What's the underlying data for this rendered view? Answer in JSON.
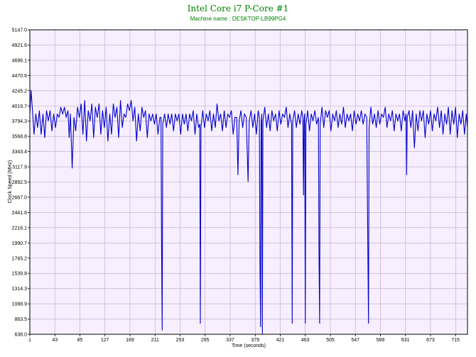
{
  "chart_data": {
    "type": "line",
    "title": "Intel Core i7 P-Core #1",
    "subtitle": "Machine name : DESKTOP-LB99PG4",
    "xlabel": "Time (seconds)",
    "ylabel": "Clock Speed (MHz)",
    "xlim": [
      1,
      735
    ],
    "ylim": [
      638.0,
      5147.0
    ],
    "xticks": [
      1,
      43,
      85,
      127,
      169,
      211,
      253,
      295,
      337,
      379,
      421,
      463,
      505,
      547,
      589,
      631,
      673,
      715
    ],
    "yticks": [
      638.0,
      863.5,
      1088.9,
      1314.3,
      1539.8,
      1765.2,
      1990.7,
      2216.1,
      2441.6,
      2667.0,
      2892.5,
      3117.9,
      3343.4,
      3568.8,
      3794.3,
      4019.7,
      4245.2,
      4470.6,
      4696.1,
      4921.6,
      5147.0
    ],
    "grid": true,
    "colors": {
      "line": "#0000cc",
      "plot_bg": "#f7eeff",
      "grid": "#b9a8c8",
      "title": "#008000"
    },
    "series": [
      {
        "values": [
          {
            "x": 1,
            "y": 3900
          },
          {
            "x": 3,
            "y": 4250
          },
          {
            "x": 5,
            "y": 4000
          },
          {
            "x": 8,
            "y": 3600
          },
          {
            "x": 11,
            "y": 3900
          },
          {
            "x": 14,
            "y": 3700
          },
          {
            "x": 17,
            "y": 3950
          },
          {
            "x": 20,
            "y": 3600
          },
          {
            "x": 23,
            "y": 3900
          },
          {
            "x": 26,
            "y": 3550
          },
          {
            "x": 29,
            "y": 3950
          },
          {
            "x": 32,
            "y": 3800
          },
          {
            "x": 35,
            "y": 3950
          },
          {
            "x": 38,
            "y": 3650
          },
          {
            "x": 41,
            "y": 3900
          },
          {
            "x": 44,
            "y": 3700
          },
          {
            "x": 47,
            "y": 3900
          },
          {
            "x": 50,
            "y": 3850
          },
          {
            "x": 53,
            "y": 4000
          },
          {
            "x": 56,
            "y": 3900
          },
          {
            "x": 59,
            "y": 4000
          },
          {
            "x": 62,
            "y": 3850
          },
          {
            "x": 65,
            "y": 3950
          },
          {
            "x": 67,
            "y": 3550
          },
          {
            "x": 69,
            "y": 3900
          },
          {
            "x": 72,
            "y": 3100
          },
          {
            "x": 75,
            "y": 3850
          },
          {
            "x": 78,
            "y": 3650
          },
          {
            "x": 81,
            "y": 4000
          },
          {
            "x": 84,
            "y": 3850
          },
          {
            "x": 87,
            "y": 4050
          },
          {
            "x": 90,
            "y": 3600
          },
          {
            "x": 93,
            "y": 4100
          },
          {
            "x": 96,
            "y": 3500
          },
          {
            "x": 99,
            "y": 3950
          },
          {
            "x": 102,
            "y": 3800
          },
          {
            "x": 105,
            "y": 4050
          },
          {
            "x": 108,
            "y": 3550
          },
          {
            "x": 111,
            "y": 4000
          },
          {
            "x": 114,
            "y": 3850
          },
          {
            "x": 117,
            "y": 4050
          },
          {
            "x": 120,
            "y": 3600
          },
          {
            "x": 123,
            "y": 3950
          },
          {
            "x": 126,
            "y": 3700
          },
          {
            "x": 129,
            "y": 4000
          },
          {
            "x": 132,
            "y": 3500
          },
          {
            "x": 135,
            "y": 3900
          },
          {
            "x": 138,
            "y": 3600
          },
          {
            "x": 141,
            "y": 4050
          },
          {
            "x": 144,
            "y": 3850
          },
          {
            "x": 147,
            "y": 4000
          },
          {
            "x": 150,
            "y": 3550
          },
          {
            "x": 153,
            "y": 4100
          },
          {
            "x": 156,
            "y": 3700
          },
          {
            "x": 159,
            "y": 3900
          },
          {
            "x": 162,
            "y": 3850
          },
          {
            "x": 165,
            "y": 4050
          },
          {
            "x": 168,
            "y": 3950
          },
          {
            "x": 171,
            "y": 4100
          },
          {
            "x": 174,
            "y": 3800
          },
          {
            "x": 177,
            "y": 4000
          },
          {
            "x": 180,
            "y": 3500
          },
          {
            "x": 183,
            "y": 3900
          },
          {
            "x": 186,
            "y": 3650
          },
          {
            "x": 189,
            "y": 4000
          },
          {
            "x": 192,
            "y": 3850
          },
          {
            "x": 195,
            "y": 3950
          },
          {
            "x": 198,
            "y": 3550
          },
          {
            "x": 201,
            "y": 3900
          },
          {
            "x": 204,
            "y": 3800
          },
          {
            "x": 207,
            "y": 3900
          },
          {
            "x": 210,
            "y": 3750
          },
          {
            "x": 213,
            "y": 3900
          },
          {
            "x": 216,
            "y": 3600
          },
          {
            "x": 219,
            "y": 3850
          },
          {
            "x": 221,
            "y": 3850
          },
          {
            "x": 222,
            "y": 1850
          },
          {
            "x": 223,
            "y": 700
          },
          {
            "x": 224,
            "y": 3750
          },
          {
            "x": 227,
            "y": 3900
          },
          {
            "x": 230,
            "y": 3700
          },
          {
            "x": 233,
            "y": 3900
          },
          {
            "x": 236,
            "y": 3750
          },
          {
            "x": 239,
            "y": 3900
          },
          {
            "x": 242,
            "y": 3650
          },
          {
            "x": 245,
            "y": 3900
          },
          {
            "x": 248,
            "y": 3800
          },
          {
            "x": 251,
            "y": 3900
          },
          {
            "x": 254,
            "y": 3600
          },
          {
            "x": 257,
            "y": 3900
          },
          {
            "x": 260,
            "y": 3750
          },
          {
            "x": 263,
            "y": 3900
          },
          {
            "x": 266,
            "y": 3650
          },
          {
            "x": 269,
            "y": 3900
          },
          {
            "x": 272,
            "y": 3800
          },
          {
            "x": 275,
            "y": 3950
          },
          {
            "x": 278,
            "y": 3600
          },
          {
            "x": 281,
            "y": 3900
          },
          {
            "x": 284,
            "y": 3700
          },
          {
            "x": 286,
            "y": 3750
          },
          {
            "x": 287,
            "y": 800
          },
          {
            "x": 288,
            "y": 3700
          },
          {
            "x": 291,
            "y": 3950
          },
          {
            "x": 294,
            "y": 3700
          },
          {
            "x": 297,
            "y": 3900
          },
          {
            "x": 300,
            "y": 3800
          },
          {
            "x": 303,
            "y": 3950
          },
          {
            "x": 306,
            "y": 3650
          },
          {
            "x": 309,
            "y": 3900
          },
          {
            "x": 312,
            "y": 3700
          },
          {
            "x": 315,
            "y": 4050
          },
          {
            "x": 318,
            "y": 3800
          },
          {
            "x": 321,
            "y": 3900
          },
          {
            "x": 324,
            "y": 3650
          },
          {
            "x": 327,
            "y": 3950
          },
          {
            "x": 330,
            "y": 3700
          },
          {
            "x": 333,
            "y": 3900
          },
          {
            "x": 336,
            "y": 3850
          },
          {
            "x": 339,
            "y": 3950
          },
          {
            "x": 342,
            "y": 3600
          },
          {
            "x": 345,
            "y": 3850
          },
          {
            "x": 348,
            "y": 3850
          },
          {
            "x": 350,
            "y": 3000
          },
          {
            "x": 352,
            "y": 3800
          },
          {
            "x": 355,
            "y": 3950
          },
          {
            "x": 358,
            "y": 3700
          },
          {
            "x": 361,
            "y": 3900
          },
          {
            "x": 364,
            "y": 3850
          },
          {
            "x": 367,
            "y": 2900
          },
          {
            "x": 369,
            "y": 3800
          },
          {
            "x": 372,
            "y": 3950
          },
          {
            "x": 375,
            "y": 3700
          },
          {
            "x": 378,
            "y": 3900
          },
          {
            "x": 381,
            "y": 3600
          },
          {
            "x": 384,
            "y": 3950
          },
          {
            "x": 386,
            "y": 3850
          },
          {
            "x": 387,
            "y": 1700
          },
          {
            "x": 388,
            "y": 750
          },
          {
            "x": 389,
            "y": 3750
          },
          {
            "x": 390,
            "y": 3900
          },
          {
            "x": 391,
            "y": 650
          },
          {
            "x": 392,
            "y": 3800
          },
          {
            "x": 395,
            "y": 4000
          },
          {
            "x": 398,
            "y": 3700
          },
          {
            "x": 401,
            "y": 3900
          },
          {
            "x": 404,
            "y": 3650
          },
          {
            "x": 407,
            "y": 3950
          },
          {
            "x": 410,
            "y": 3800
          },
          {
            "x": 413,
            "y": 3900
          },
          {
            "x": 416,
            "y": 3650
          },
          {
            "x": 419,
            "y": 3950
          },
          {
            "x": 422,
            "y": 3750
          },
          {
            "x": 425,
            "y": 3900
          },
          {
            "x": 428,
            "y": 3850
          },
          {
            "x": 431,
            "y": 4000
          },
          {
            "x": 434,
            "y": 3700
          },
          {
            "x": 437,
            "y": 3900
          },
          {
            "x": 440,
            "y": 3750
          },
          {
            "x": 441,
            "y": 800
          },
          {
            "x": 442,
            "y": 3800
          },
          {
            "x": 445,
            "y": 3950
          },
          {
            "x": 448,
            "y": 3700
          },
          {
            "x": 451,
            "y": 3900
          },
          {
            "x": 454,
            "y": 3750
          },
          {
            "x": 457,
            "y": 3950
          },
          {
            "x": 459,
            "y": 3850
          },
          {
            "x": 460,
            "y": 2700
          },
          {
            "x": 461,
            "y": 3800
          },
          {
            "x": 462,
            "y": 3900
          },
          {
            "x": 463,
            "y": 800
          },
          {
            "x": 464,
            "y": 3750
          },
          {
            "x": 467,
            "y": 3950
          },
          {
            "x": 470,
            "y": 3650
          },
          {
            "x": 473,
            "y": 3900
          },
          {
            "x": 476,
            "y": 3800
          },
          {
            "x": 479,
            "y": 3950
          },
          {
            "x": 482,
            "y": 3750
          },
          {
            "x": 485,
            "y": 3850
          },
          {
            "x": 486,
            "y": 1850
          },
          {
            "x": 487,
            "y": 800
          },
          {
            "x": 488,
            "y": 3750
          },
          {
            "x": 491,
            "y": 4000
          },
          {
            "x": 494,
            "y": 3700
          },
          {
            "x": 497,
            "y": 3950
          },
          {
            "x": 500,
            "y": 3850
          },
          {
            "x": 503,
            "y": 3950
          },
          {
            "x": 506,
            "y": 3650
          },
          {
            "x": 509,
            "y": 3900
          },
          {
            "x": 512,
            "y": 3800
          },
          {
            "x": 515,
            "y": 3950
          },
          {
            "x": 518,
            "y": 3700
          },
          {
            "x": 521,
            "y": 3900
          },
          {
            "x": 524,
            "y": 3750
          },
          {
            "x": 527,
            "y": 4000
          },
          {
            "x": 530,
            "y": 3700
          },
          {
            "x": 533,
            "y": 3900
          },
          {
            "x": 536,
            "y": 3800
          },
          {
            "x": 539,
            "y": 3900
          },
          {
            "x": 542,
            "y": 3650
          },
          {
            "x": 545,
            "y": 3950
          },
          {
            "x": 548,
            "y": 3750
          },
          {
            "x": 551,
            "y": 3900
          },
          {
            "x": 554,
            "y": 3800
          },
          {
            "x": 557,
            "y": 3950
          },
          {
            "x": 560,
            "y": 3750
          },
          {
            "x": 563,
            "y": 3900
          },
          {
            "x": 566,
            "y": 3850
          },
          {
            "x": 568,
            "y": 1850
          },
          {
            "x": 569,
            "y": 800
          },
          {
            "x": 570,
            "y": 3700
          },
          {
            "x": 573,
            "y": 4000
          },
          {
            "x": 576,
            "y": 3750
          },
          {
            "x": 579,
            "y": 3900
          },
          {
            "x": 582,
            "y": 3700
          },
          {
            "x": 585,
            "y": 3950
          },
          {
            "x": 588,
            "y": 3750
          },
          {
            "x": 591,
            "y": 3900
          },
          {
            "x": 594,
            "y": 3850
          },
          {
            "x": 597,
            "y": 4000
          },
          {
            "x": 600,
            "y": 3700
          },
          {
            "x": 603,
            "y": 3900
          },
          {
            "x": 606,
            "y": 3800
          },
          {
            "x": 609,
            "y": 3950
          },
          {
            "x": 612,
            "y": 3650
          },
          {
            "x": 615,
            "y": 3900
          },
          {
            "x": 618,
            "y": 3800
          },
          {
            "x": 621,
            "y": 3900
          },
          {
            "x": 624,
            "y": 3650
          },
          {
            "x": 627,
            "y": 3950
          },
          {
            "x": 630,
            "y": 3800
          },
          {
            "x": 632,
            "y": 3900
          },
          {
            "x": 633,
            "y": 3000
          },
          {
            "x": 634,
            "y": 3850
          },
          {
            "x": 637,
            "y": 3950
          },
          {
            "x": 640,
            "y": 3700
          },
          {
            "x": 643,
            "y": 3950
          },
          {
            "x": 646,
            "y": 3400
          },
          {
            "x": 649,
            "y": 3900
          },
          {
            "x": 652,
            "y": 3650
          },
          {
            "x": 655,
            "y": 3950
          },
          {
            "x": 658,
            "y": 3800
          },
          {
            "x": 661,
            "y": 3950
          },
          {
            "x": 664,
            "y": 3550
          },
          {
            "x": 667,
            "y": 3900
          },
          {
            "x": 670,
            "y": 3750
          },
          {
            "x": 673,
            "y": 3950
          },
          {
            "x": 676,
            "y": 3650
          },
          {
            "x": 679,
            "y": 3900
          },
          {
            "x": 682,
            "y": 3800
          },
          {
            "x": 685,
            "y": 4000
          },
          {
            "x": 688,
            "y": 3700
          },
          {
            "x": 691,
            "y": 3950
          },
          {
            "x": 694,
            "y": 3600
          },
          {
            "x": 697,
            "y": 3900
          },
          {
            "x": 700,
            "y": 3750
          },
          {
            "x": 703,
            "y": 4000
          },
          {
            "x": 706,
            "y": 3600
          },
          {
            "x": 709,
            "y": 3950
          },
          {
            "x": 712,
            "y": 3750
          },
          {
            "x": 715,
            "y": 4000
          },
          {
            "x": 718,
            "y": 3550
          },
          {
            "x": 721,
            "y": 3900
          },
          {
            "x": 724,
            "y": 3750
          },
          {
            "x": 727,
            "y": 3950
          },
          {
            "x": 730,
            "y": 3600
          },
          {
            "x": 733,
            "y": 3900
          },
          {
            "x": 735,
            "y": 3700
          }
        ]
      }
    ]
  }
}
